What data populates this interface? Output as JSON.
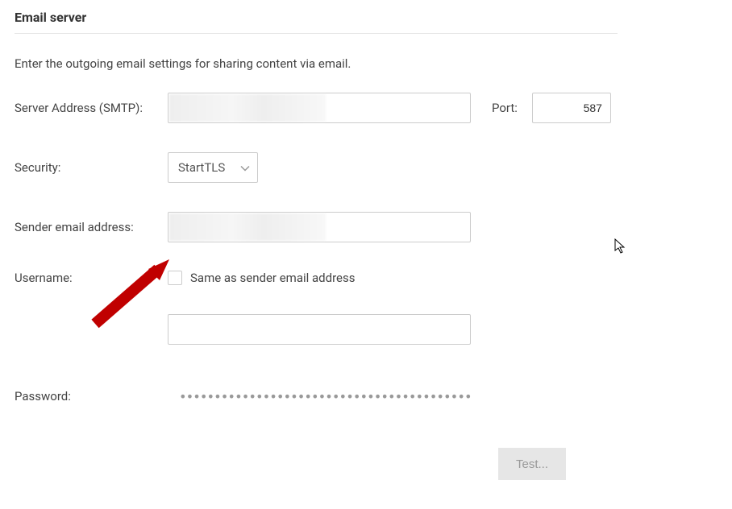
{
  "section": {
    "title": "Email server",
    "description": "Enter the outgoing email settings for sharing content via email."
  },
  "labels": {
    "server_address": "Server Address (SMTP):",
    "port": "Port:",
    "security": "Security:",
    "sender_email": "Sender email address:",
    "username": "Username:",
    "same_as_sender": "Same as sender email address",
    "password": "Password:"
  },
  "values": {
    "port": "587",
    "security_selected": "StartTLS",
    "password_mask": "••••••••••••••••••••••••••••••••••••••••••••••"
  },
  "buttons": {
    "test": "Test..."
  }
}
